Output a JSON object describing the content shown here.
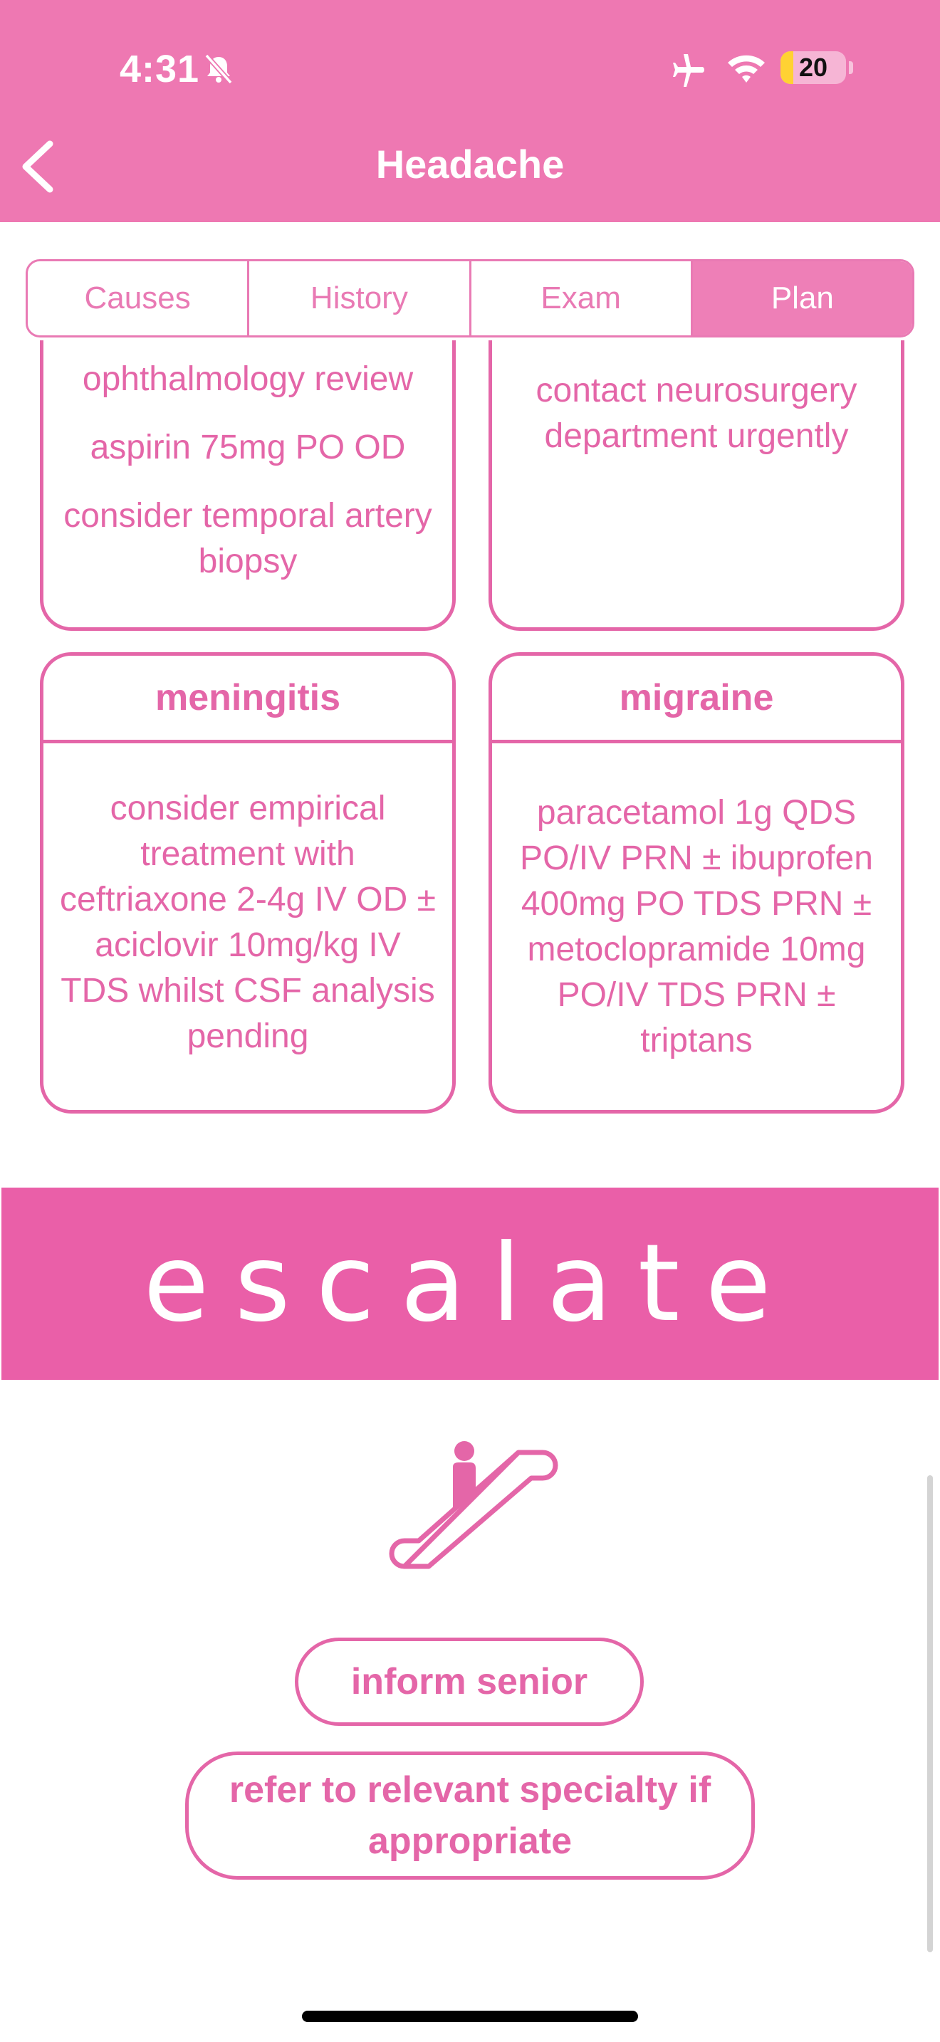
{
  "status_bar": {
    "time": "4:31",
    "battery": "20",
    "battery_level": 0.2
  },
  "nav": {
    "title": "Headache"
  },
  "tabs": [
    {
      "label": "Causes",
      "active": false
    },
    {
      "label": "History",
      "active": false
    },
    {
      "label": "Exam",
      "active": false
    },
    {
      "label": "Plan",
      "active": true
    }
  ],
  "cards_top": {
    "left": {
      "items": [
        "ophthalmology review",
        "aspirin 75mg PO OD",
        "consider temporal artery biopsy"
      ]
    },
    "right": {
      "items": [
        "contact neurosurgery department urgently"
      ]
    }
  },
  "cards": [
    {
      "title": "meningitis",
      "body": "consider empirical treatment with ceftriaxone 2-4g IV OD ± aciclovir 10mg/kg IV TDS whilst CSF analysis pending"
    },
    {
      "title": "migraine",
      "body": "paracetamol 1g QDS PO/IV PRN ± ibuprofen 400mg PO TDS PRN ± metoclopramide 10mg PO/IV TDS PRN ± triptans"
    }
  ],
  "escalate": {
    "banner": "escalate",
    "icon": "escalator-icon",
    "actions": [
      "inform senior",
      "refer to relevant specialty if appropriate"
    ]
  },
  "colors": {
    "header": "#ee78b2",
    "accent": "#e466a8",
    "banner": "#ea5fa8"
  }
}
